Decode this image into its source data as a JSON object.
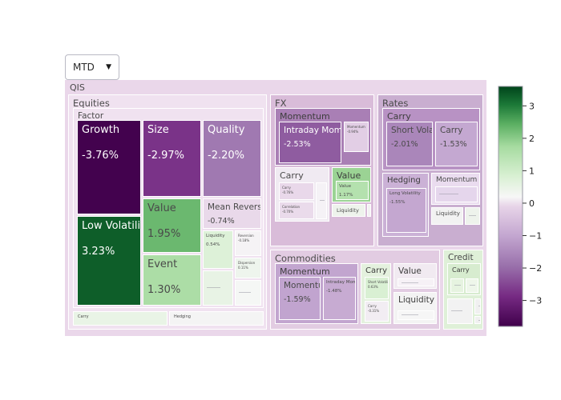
{
  "controls": {
    "period_dropdown": {
      "name": "period-select",
      "value": "MTD",
      "caret": "▼"
    }
  },
  "colorbar": {
    "colormap": "PRGn",
    "ticks": [
      "3",
      "2",
      "1",
      "0",
      "−1",
      "−2",
      "−3"
    ],
    "vmin": -3.8,
    "vmax": 3.6,
    "negative_color": "#40004b",
    "midpoint_color": "#f7f7f7",
    "positive_color": "#00441b"
  },
  "treemap": {
    "root_label": "QIS",
    "sectors": [
      {
        "label": "Equities",
        "groups": [
          {
            "label": "Factor",
            "leaves": [
              {
                "label": "Growth",
                "value": "-3.76%",
                "num": -3.76
              },
              {
                "label": "Size",
                "value": "-2.97%",
                "num": -2.97
              },
              {
                "label": "Quality",
                "value": "-2.20%",
                "num": -2.2
              },
              {
                "label": "Low Volatility",
                "value": "3.23%",
                "num": 3.23
              },
              {
                "label": "Value",
                "value": "1.95%",
                "num": 1.95
              },
              {
                "label": "Event",
                "value": "1.30%",
                "num": 1.3
              },
              {
                "label": "Mean Reversion",
                "value": "-0.74%",
                "num": -0.74
              },
              {
                "label": "Liquidity",
                "value": "0.54%",
                "num": 0.54
              },
              {
                "label": "Reversion",
                "value": "-0.18%",
                "num": -0.18
              },
              {
                "label": "Dispersion",
                "value": "0.11%",
                "num": 0.11
              },
              {
                "label": "Risk Premia",
                "value": "0.28%",
                "num": 0.28
              },
              {
                "label": "Short Volatility",
                "value": "-0.06%",
                "num": -0.06
              }
            ]
          },
          {
            "label": "Carry",
            "leaves": []
          },
          {
            "label": "Hedging",
            "leaves": []
          }
        ]
      },
      {
        "label": "FX",
        "groups": [
          {
            "label": "Momentum",
            "leaves": [
              {
                "label": "Intraday Momentum",
                "value": "-2.53%",
                "num": -2.53
              },
              {
                "label": "Momentum",
                "value": "-0.94%",
                "num": -0.94
              }
            ]
          },
          {
            "label": "Carry",
            "leaves": [
              {
                "label": "Carry",
                "value": "-0.76%",
                "num": -0.76
              },
              {
                "label": "Correlation",
                "value": "-0.70%",
                "num": -0.7
              }
            ]
          },
          {
            "label": "Value",
            "leaves": [
              {
                "label": "Value",
                "value": "1.17%",
                "num": 1.17
              }
            ]
          },
          {
            "label": "Liquidity",
            "leaves": []
          }
        ]
      },
      {
        "label": "Rates",
        "groups": [
          {
            "label": "Carry",
            "leaves": [
              {
                "label": "Short Volatility",
                "value": "-2.01%",
                "num": -2.01
              },
              {
                "label": "Carry",
                "value": "-1.53%",
                "num": -1.53
              }
            ]
          },
          {
            "label": "Hedging",
            "leaves": [
              {
                "label": "Long Volatility",
                "value": "-1.55%",
                "num": -1.55
              }
            ]
          },
          {
            "label": "Momentum",
            "leaves": []
          },
          {
            "label": "Liquidity",
            "leaves": []
          }
        ]
      },
      {
        "label": "Commodities",
        "groups": [
          {
            "label": "Momentum",
            "leaves": [
              {
                "label": "Momentum",
                "value": "-1.59%",
                "num": -1.59
              },
              {
                "label": "Intraday Momentum",
                "value": "-1.48%",
                "num": -1.48
              }
            ]
          },
          {
            "label": "Carry",
            "leaves": [
              {
                "label": "Short Volatility",
                "value": "0.63%",
                "num": 0.63
              },
              {
                "label": "Carry",
                "value": "-0.31%",
                "num": -0.31
              }
            ]
          },
          {
            "label": "Value",
            "leaves": []
          },
          {
            "label": "Liquidity",
            "leaves": []
          }
        ]
      },
      {
        "label": "Credit",
        "groups": [
          {
            "label": "Carry",
            "leaves": []
          }
        ]
      }
    ]
  }
}
